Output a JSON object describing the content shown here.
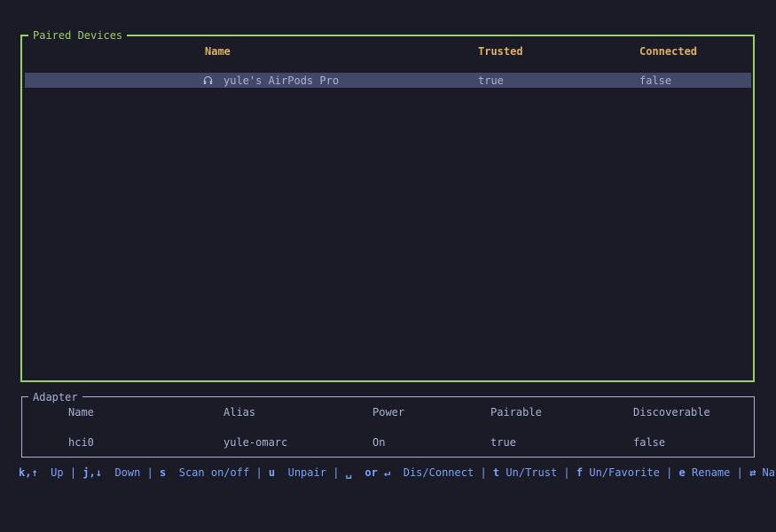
{
  "paired": {
    "title": "Paired Devices",
    "headers": {
      "name": "Name",
      "trusted": "Trusted",
      "connected": "Connected"
    },
    "rows": [
      {
        "icon": "headphones-icon",
        "name": "yule's AirPods Pro",
        "trusted": "true",
        "connected": "false"
      }
    ]
  },
  "adapter": {
    "title": "Adapter",
    "headers": {
      "name": "Name",
      "alias": "Alias",
      "power": "Power",
      "pairable": "Pairable",
      "discoverable": "Discoverable"
    },
    "row": {
      "name": "hci0",
      "alias": "yule-omarc",
      "power": "On",
      "pairable": "true",
      "discoverable": "false"
    }
  },
  "footer": {
    "up_key": "k,↑",
    "up": "Up",
    "down_key": "j,↓",
    "down": "Down",
    "scan_key": "s",
    "scan": "Scan on/off",
    "unpair_key": "u",
    "unpair": "Unpair",
    "space_key": "␣",
    "or": "or",
    "enter_key": "↵",
    "connect": "Dis/Connect",
    "trust_key": "t",
    "trust": "Un/Trust",
    "fav_key": "f",
    "fav": "Un/Favorite",
    "rename_key": "e",
    "rename": "Rename",
    "nav_key": "⇄",
    "nav": "Nav",
    "separator": "|"
  },
  "colors": {
    "accent": "#9ece6a",
    "header": "#e0af68",
    "text": "#a9b1d6",
    "selection": "#414868",
    "hint": "#7aa2f7"
  }
}
